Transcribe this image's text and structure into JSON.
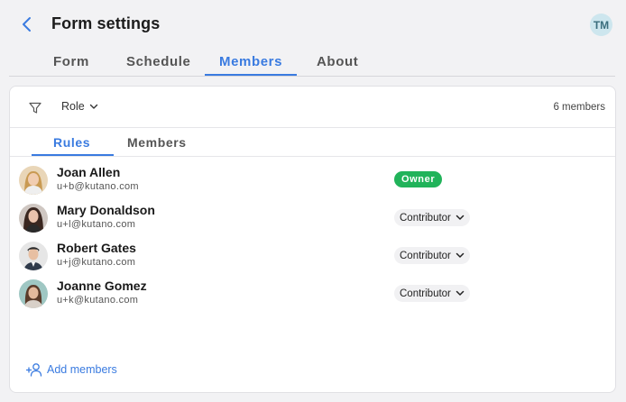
{
  "header": {
    "title": "Form settings",
    "user_initials": "TM"
  },
  "tabs": [
    {
      "label": "Form"
    },
    {
      "label": "Schedule"
    },
    {
      "label": "Members",
      "active": true
    },
    {
      "label": "About"
    }
  ],
  "filter": {
    "role_label": "Role",
    "member_count": "6 members"
  },
  "subtabs": [
    {
      "label": "Rules",
      "active": true
    },
    {
      "label": "Members"
    }
  ],
  "members": [
    {
      "name": "Joan Allen",
      "email": "u+b@kutano.com",
      "role": "Owner"
    },
    {
      "name": "Mary Donaldson",
      "email": "u+l@kutano.com",
      "role": "Contributor"
    },
    {
      "name": "Robert Gates",
      "email": "u+j@kutano.com",
      "role": "Contributor"
    },
    {
      "name": "Joanne Gomez",
      "email": "u+k@kutano.com",
      "role": "Contributor"
    }
  ],
  "add_members_label": "Add members",
  "colors": {
    "accent": "#3a7be0",
    "owner_badge": "#21b35a"
  }
}
